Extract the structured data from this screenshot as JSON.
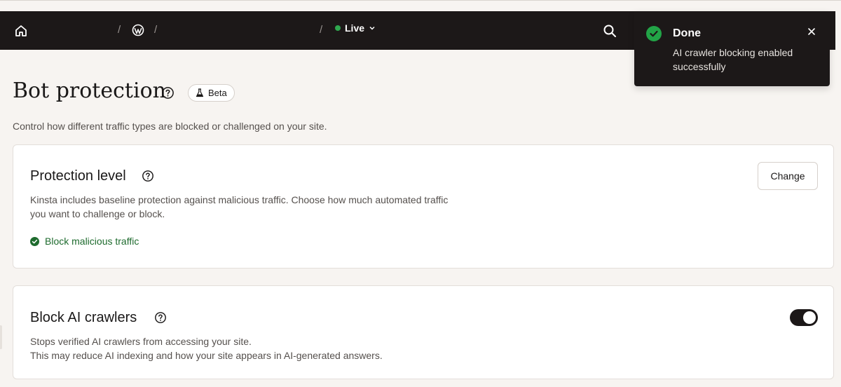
{
  "topbar": {
    "breadcrumb_separator": "/",
    "environment_label": "Live",
    "environment_status_color": "#2fa84f",
    "icons": [
      "home-icon",
      "wordpress-icon",
      "chevron-down-icon",
      "search-icon"
    ]
  },
  "toast": {
    "title": "Done",
    "message": "AI crawler blocking enabled successfully",
    "icons": [
      "check-circle-icon",
      "close-icon"
    ],
    "status_color": "#22a447"
  },
  "page": {
    "title": "Bot protection",
    "badge": "Beta",
    "subtitle": "Control how different traffic types are blocked or challenged on your site."
  },
  "protection_card": {
    "title": "Protection level",
    "description": "Kinsta includes baseline protection against malicious traffic. Choose how much automated traffic you want to challenge or block.",
    "status": "Block malicious traffic",
    "status_color": "#1e6b2e",
    "button_label": "Change"
  },
  "ai_card": {
    "title": "Block AI crawlers",
    "description_line1": "Stops verified AI crawlers from accessing your site.",
    "description_line2": "This may reduce AI indexing and how your site appears in AI-generated answers.",
    "toggle_on": true
  }
}
